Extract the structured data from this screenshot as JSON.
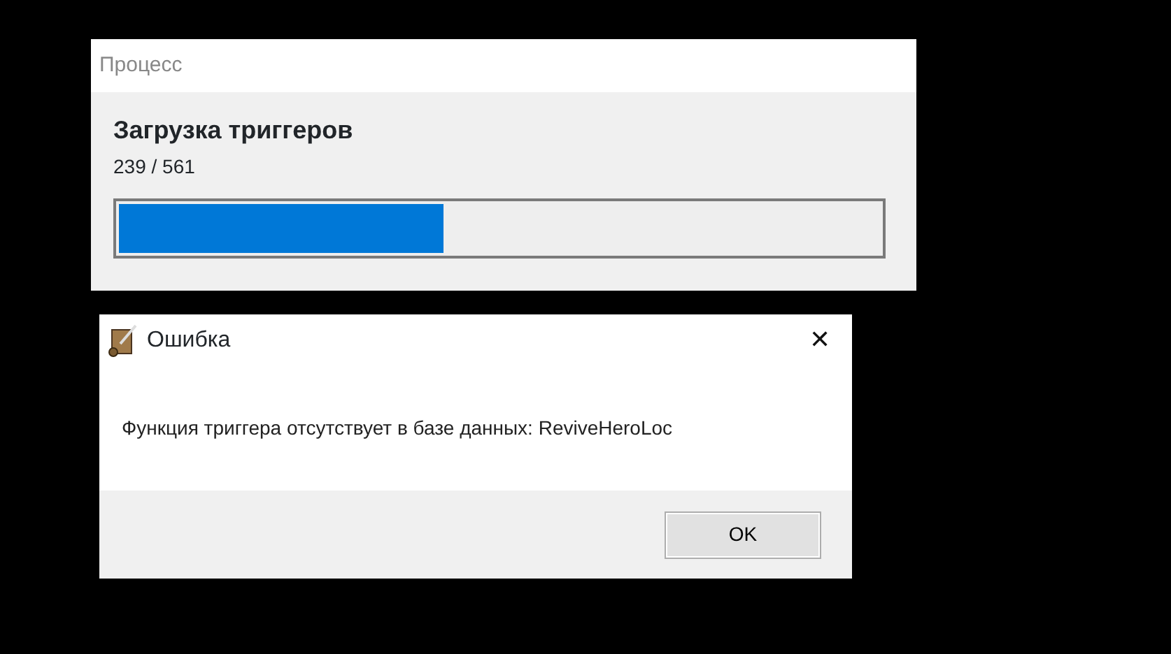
{
  "progress_window": {
    "title": "Процесс",
    "heading": "Загрузка триггеров",
    "count": "239 / 561",
    "progress": {
      "level": 0.426
    }
  },
  "error_dialog": {
    "title": "Ошибка",
    "close": "✕",
    "message": "Функция триггера отсутствует в базе данных: ReviveHeroLoc",
    "buttons": [
      "OK"
    ]
  }
}
